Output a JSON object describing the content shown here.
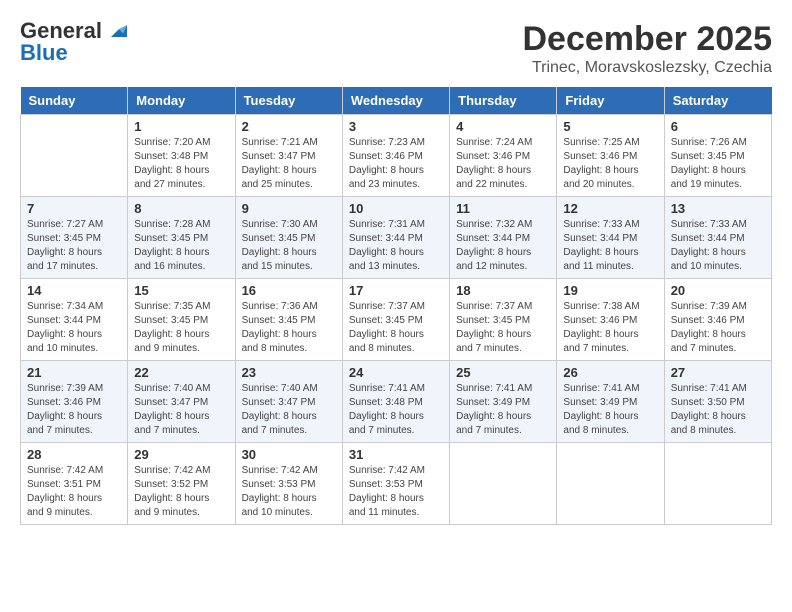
{
  "header": {
    "logo_general": "General",
    "logo_blue": "Blue",
    "month": "December 2025",
    "location": "Trinec, Moravskoslezsky, Czechia"
  },
  "days_of_week": [
    "Sunday",
    "Monday",
    "Tuesday",
    "Wednesday",
    "Thursday",
    "Friday",
    "Saturday"
  ],
  "weeks": [
    [
      {
        "day": "",
        "info": ""
      },
      {
        "day": "1",
        "info": "Sunrise: 7:20 AM\nSunset: 3:48 PM\nDaylight: 8 hours\nand 27 minutes."
      },
      {
        "day": "2",
        "info": "Sunrise: 7:21 AM\nSunset: 3:47 PM\nDaylight: 8 hours\nand 25 minutes."
      },
      {
        "day": "3",
        "info": "Sunrise: 7:23 AM\nSunset: 3:46 PM\nDaylight: 8 hours\nand 23 minutes."
      },
      {
        "day": "4",
        "info": "Sunrise: 7:24 AM\nSunset: 3:46 PM\nDaylight: 8 hours\nand 22 minutes."
      },
      {
        "day": "5",
        "info": "Sunrise: 7:25 AM\nSunset: 3:46 PM\nDaylight: 8 hours\nand 20 minutes."
      },
      {
        "day": "6",
        "info": "Sunrise: 7:26 AM\nSunset: 3:45 PM\nDaylight: 8 hours\nand 19 minutes."
      }
    ],
    [
      {
        "day": "7",
        "info": "Sunrise: 7:27 AM\nSunset: 3:45 PM\nDaylight: 8 hours\nand 17 minutes."
      },
      {
        "day": "8",
        "info": "Sunrise: 7:28 AM\nSunset: 3:45 PM\nDaylight: 8 hours\nand 16 minutes."
      },
      {
        "day": "9",
        "info": "Sunrise: 7:30 AM\nSunset: 3:45 PM\nDaylight: 8 hours\nand 15 minutes."
      },
      {
        "day": "10",
        "info": "Sunrise: 7:31 AM\nSunset: 3:44 PM\nDaylight: 8 hours\nand 13 minutes."
      },
      {
        "day": "11",
        "info": "Sunrise: 7:32 AM\nSunset: 3:44 PM\nDaylight: 8 hours\nand 12 minutes."
      },
      {
        "day": "12",
        "info": "Sunrise: 7:33 AM\nSunset: 3:44 PM\nDaylight: 8 hours\nand 11 minutes."
      },
      {
        "day": "13",
        "info": "Sunrise: 7:33 AM\nSunset: 3:44 PM\nDaylight: 8 hours\nand 10 minutes."
      }
    ],
    [
      {
        "day": "14",
        "info": "Sunrise: 7:34 AM\nSunset: 3:44 PM\nDaylight: 8 hours\nand 10 minutes."
      },
      {
        "day": "15",
        "info": "Sunrise: 7:35 AM\nSunset: 3:45 PM\nDaylight: 8 hours\nand 9 minutes."
      },
      {
        "day": "16",
        "info": "Sunrise: 7:36 AM\nSunset: 3:45 PM\nDaylight: 8 hours\nand 8 minutes."
      },
      {
        "day": "17",
        "info": "Sunrise: 7:37 AM\nSunset: 3:45 PM\nDaylight: 8 hours\nand 8 minutes."
      },
      {
        "day": "18",
        "info": "Sunrise: 7:37 AM\nSunset: 3:45 PM\nDaylight: 8 hours\nand 7 minutes."
      },
      {
        "day": "19",
        "info": "Sunrise: 7:38 AM\nSunset: 3:46 PM\nDaylight: 8 hours\nand 7 minutes."
      },
      {
        "day": "20",
        "info": "Sunrise: 7:39 AM\nSunset: 3:46 PM\nDaylight: 8 hours\nand 7 minutes."
      }
    ],
    [
      {
        "day": "21",
        "info": "Sunrise: 7:39 AM\nSunset: 3:46 PM\nDaylight: 8 hours\nand 7 minutes."
      },
      {
        "day": "22",
        "info": "Sunrise: 7:40 AM\nSunset: 3:47 PM\nDaylight: 8 hours\nand 7 minutes."
      },
      {
        "day": "23",
        "info": "Sunrise: 7:40 AM\nSunset: 3:47 PM\nDaylight: 8 hours\nand 7 minutes."
      },
      {
        "day": "24",
        "info": "Sunrise: 7:41 AM\nSunset: 3:48 PM\nDaylight: 8 hours\nand 7 minutes."
      },
      {
        "day": "25",
        "info": "Sunrise: 7:41 AM\nSunset: 3:49 PM\nDaylight: 8 hours\nand 7 minutes."
      },
      {
        "day": "26",
        "info": "Sunrise: 7:41 AM\nSunset: 3:49 PM\nDaylight: 8 hours\nand 8 minutes."
      },
      {
        "day": "27",
        "info": "Sunrise: 7:41 AM\nSunset: 3:50 PM\nDaylight: 8 hours\nand 8 minutes."
      }
    ],
    [
      {
        "day": "28",
        "info": "Sunrise: 7:42 AM\nSunset: 3:51 PM\nDaylight: 8 hours\nand 9 minutes."
      },
      {
        "day": "29",
        "info": "Sunrise: 7:42 AM\nSunset: 3:52 PM\nDaylight: 8 hours\nand 9 minutes."
      },
      {
        "day": "30",
        "info": "Sunrise: 7:42 AM\nSunset: 3:53 PM\nDaylight: 8 hours\nand 10 minutes."
      },
      {
        "day": "31",
        "info": "Sunrise: 7:42 AM\nSunset: 3:53 PM\nDaylight: 8 hours\nand 11 minutes."
      },
      {
        "day": "",
        "info": ""
      },
      {
        "day": "",
        "info": ""
      },
      {
        "day": "",
        "info": ""
      }
    ]
  ]
}
